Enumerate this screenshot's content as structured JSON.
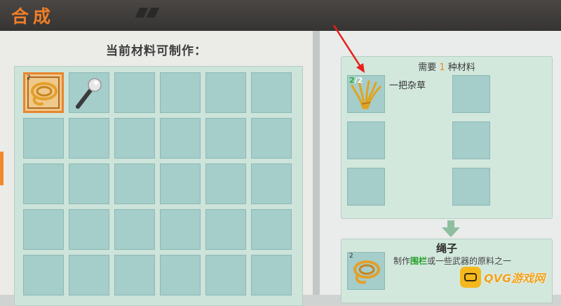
{
  "header": {
    "title": "合成"
  },
  "left": {
    "title": "当前材料可制作：",
    "items": [
      {
        "name": "rope-item",
        "icon": "rope-icon",
        "count": "2",
        "selected": true
      },
      {
        "name": "torch-item",
        "icon": "torch-icon",
        "count": "",
        "selected": false
      }
    ]
  },
  "recipe": {
    "need_prefix": "需要 ",
    "need_count": "1",
    "need_suffix": " 种材料",
    "material": {
      "name": "一把杂草",
      "have": "2",
      "sep": "/",
      "need": "2",
      "icon": "weeds-icon"
    }
  },
  "result": {
    "name": "绳子",
    "desc_before": "制作",
    "desc_highlight": "围栏",
    "desc_after": "或一些武器的原料之一",
    "count": "2",
    "icon": "rope-icon"
  },
  "watermark": {
    "text": "QVG游戏网"
  },
  "colors": {
    "accent": "#f07e27",
    "slot": "#a5cdca",
    "panel": "#cde4da",
    "have": "#2bb034"
  }
}
